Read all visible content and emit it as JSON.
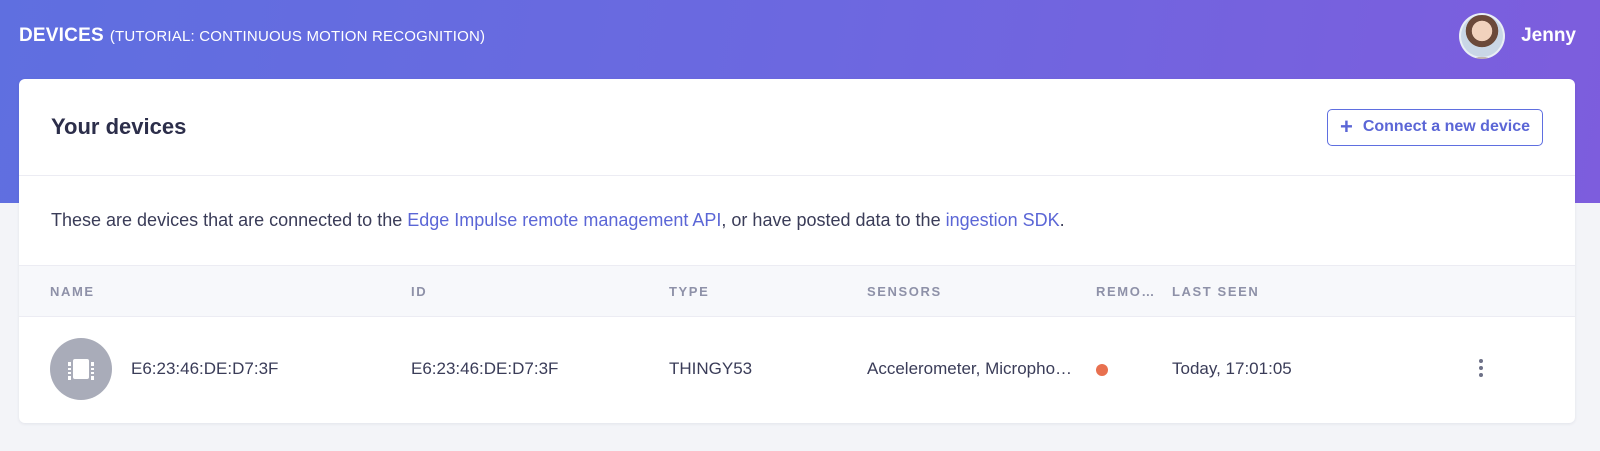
{
  "header": {
    "section": "DEVICES",
    "project": "(TUTORIAL: CONTINUOUS MOTION RECOGNITION)",
    "user_name": "Jenny"
  },
  "card": {
    "title": "Your devices",
    "connect_label": "Connect a new device",
    "connect_icon": "plus-icon",
    "description": {
      "prefix": "These are devices that are connected to the ",
      "link1": "Edge Impulse remote management API",
      "middle": ", or have posted data to the ",
      "link2": "ingestion SDK",
      "suffix": "."
    }
  },
  "table": {
    "columns": [
      "NAME",
      "ID",
      "TYPE",
      "SENSORS",
      "REMO…",
      "LAST SEEN"
    ],
    "rows": [
      {
        "icon": "chip-icon",
        "name": "E6:23:46:DE:D7:3F",
        "id": "E6:23:46:DE:D7:3F",
        "type": "THINGY53",
        "sensors": "Accelerometer, Micropho…",
        "remote_status_color": "#e8704f",
        "last_seen": "Today, 17:01:05"
      }
    ]
  },
  "colors": {
    "accent": "#5b66d6",
    "status_offline": "#e8704f"
  }
}
